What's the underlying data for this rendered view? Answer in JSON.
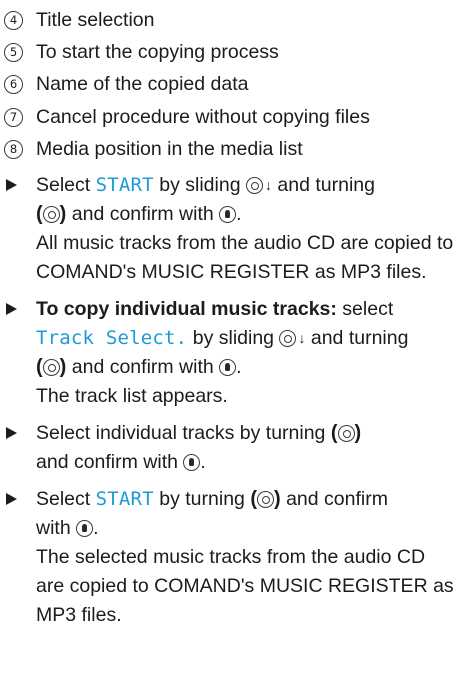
{
  "legend": [
    {
      "num": "4",
      "text": "Title selection"
    },
    {
      "num": "5",
      "text": "To start the copying process"
    },
    {
      "num": "6",
      "text": "Name of the copied data"
    },
    {
      "num": "7",
      "text": "Cancel procedure without copying files"
    },
    {
      "num": "8",
      "text": "Media position in the media list"
    }
  ],
  "steps": {
    "s1": {
      "a": "Select ",
      "kw": "START",
      "b": " by sliding ",
      "c": " and turning",
      "d": " and confirm with ",
      "e": ".",
      "result": "All music tracks from the audio CD are copied to COMAND's MUSIC REGISTER as MP3 files."
    },
    "s2": {
      "bold": "To copy individual music tracks:",
      "a": " select",
      "kw": "Track Select.",
      "b": " by sliding ",
      "c": " and turning",
      "d": " and confirm with ",
      "e": ".",
      "result": "The track list appears."
    },
    "s3": {
      "a": "Select individual tracks by turning ",
      "b": "and confirm with ",
      "c": "."
    },
    "s4": {
      "a": "Select ",
      "kw": "START",
      "b": " by turning ",
      "c": " and confirm",
      "d": "with ",
      "e": ".",
      "result": "The selected music tracks from the audio CD are copied to COMAND's MUSIC REGISTER as MP3 files."
    }
  }
}
